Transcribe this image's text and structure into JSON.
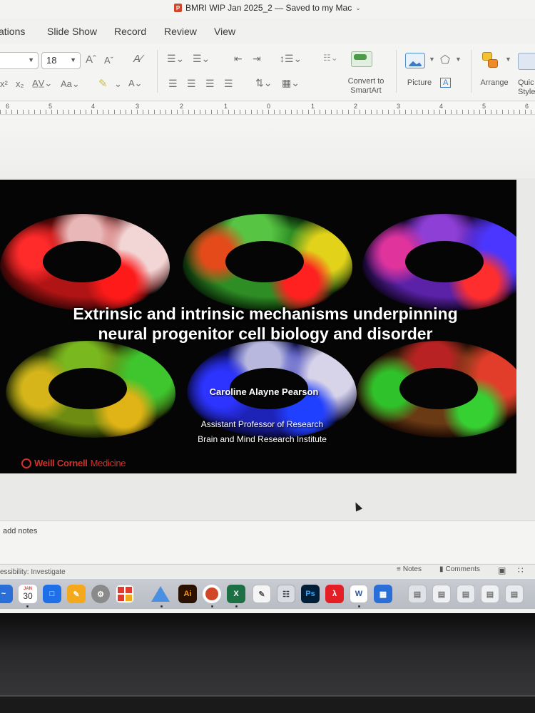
{
  "window": {
    "title": "BMRI WIP Jan 2025_2 — Saved to my Mac",
    "app_badge": "P"
  },
  "menu_tabs": [
    "ations",
    "Slide Show",
    "Record",
    "Review",
    "View"
  ],
  "ribbon": {
    "font_size": "18",
    "convert_smartart_line1": "Convert to",
    "convert_smartart_line2": "SmartArt",
    "picture_label": "Picture",
    "arrange_label": "Arrange",
    "quick_styles_line1": "Quic",
    "quick_styles_line2": "Style"
  },
  "ruler": {
    "numbers": [
      "6",
      "5",
      "4",
      "3",
      "2",
      "1",
      "0",
      "1",
      "2",
      "3",
      "4",
      "5",
      "6"
    ]
  },
  "slide": {
    "title_line1": "Extrinsic and intrinsic mechanisms underpinning",
    "title_line2": "neural progenitor cell biology and disorder",
    "author": "Caroline Alayne Pearson",
    "role": "Assistant Professor of Research",
    "institute": "Brain and Mind Research Institute",
    "logo_part1": "Weill Cornell",
    "logo_part2": "Medicine"
  },
  "notes": {
    "placeholder": "add notes"
  },
  "statusbar": {
    "accessibility": "essibility: Investigate",
    "notes_label": "Notes",
    "comments_label": "Comments"
  },
  "dock": {
    "calendar_day": "30",
    "calendar_month": "JAN",
    "illustrator": "Ai",
    "photoshop": "Ps"
  }
}
